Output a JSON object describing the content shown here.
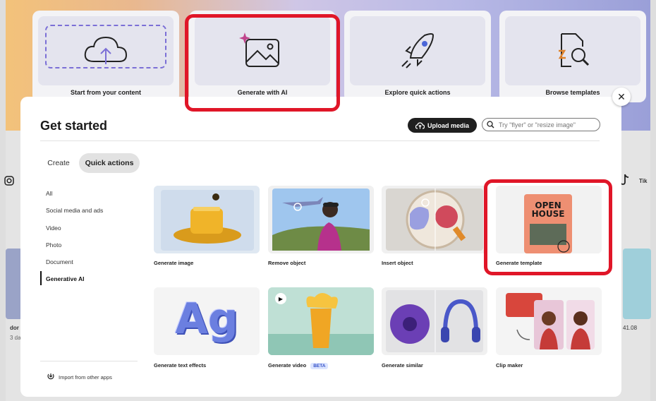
{
  "background": {
    "cards": [
      {
        "label": "Start from your content",
        "icon": "cloud-upload-icon"
      },
      {
        "label": "Generate with AI",
        "icon": "sparkle-image-icon"
      },
      {
        "label": "Explore quick actions",
        "icon": "rocket-icon"
      },
      {
        "label": "Browse templates",
        "icon": "template-search-icon"
      }
    ],
    "left_text": "dor",
    "left_subtext": "3 da",
    "right_text": "41.08",
    "right_edge_text": "Tik"
  },
  "modal": {
    "title": "Get started",
    "upload_label": "Upload media",
    "search_placeholder": "Try \"flyer\" or \"resize image\"",
    "tabs": [
      "Create",
      "Quick actions"
    ],
    "sidebar": [
      "All",
      "Social media and ads",
      "Video",
      "Photo",
      "Document",
      "Generative AI"
    ],
    "import_label": "Import from other apps",
    "tiles": [
      {
        "label": "Generate image"
      },
      {
        "label": "Remove object"
      },
      {
        "label": "Insert object"
      },
      {
        "label": "Generate template"
      },
      {
        "label": "Generate text effects",
        "art": "Ag"
      },
      {
        "label": "Generate video",
        "badge": "BETA"
      },
      {
        "label": "Generate similar"
      },
      {
        "label": "Clip maker"
      }
    ],
    "template_art": "OPEN HOUSE"
  },
  "colors": {
    "annotation": "#e01628",
    "accent": "#3451c7"
  }
}
